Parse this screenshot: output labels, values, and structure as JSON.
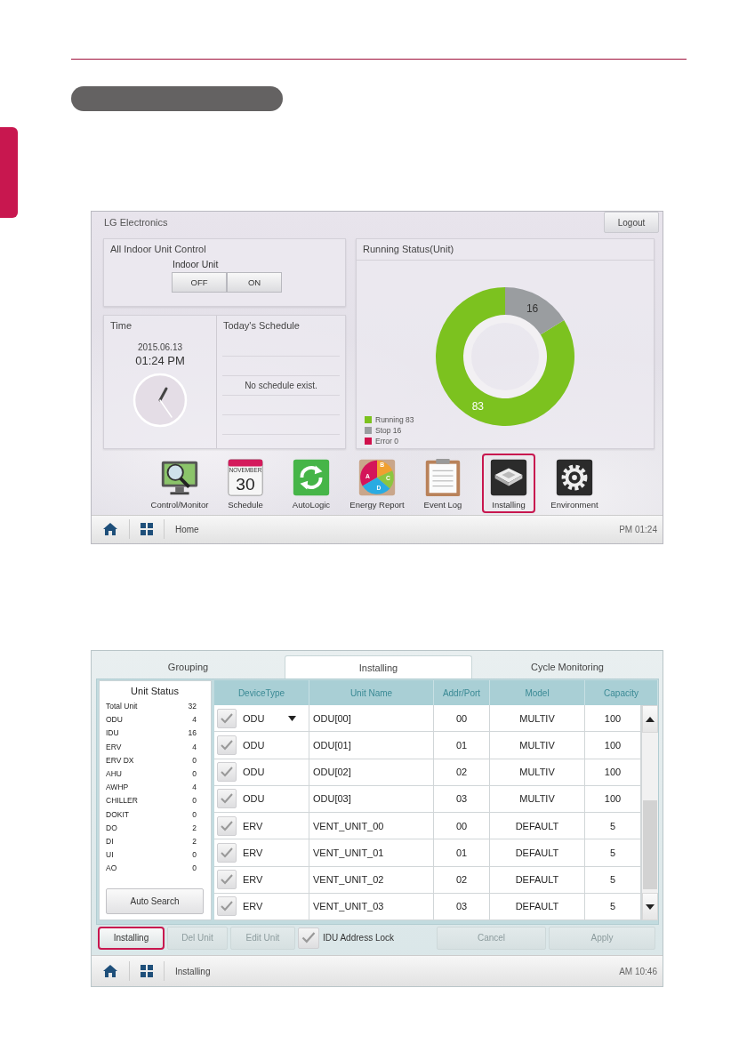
{
  "home_screen": {
    "title": "LG Electronics",
    "logout_button": "Logout",
    "indoor_control": {
      "title": "All Indoor Unit Control",
      "label": "Indoor Unit",
      "buttons": [
        "OFF",
        "ON"
      ]
    },
    "time": {
      "title": "Time",
      "date": "2015.06.13",
      "time": "01:24 PM"
    },
    "schedule": {
      "title": "Today's Schedule",
      "message": "No schedule exist."
    },
    "running_status": {
      "title": "Running Status(Unit)",
      "chart_data": {
        "type": "donut",
        "values": [
          83,
          16,
          0
        ],
        "data_labels": true
      },
      "legend": [
        {
          "label": "Running 83",
          "color": "#7cc21f"
        },
        {
          "label": "Stop 16",
          "color": "#9a9da0"
        },
        {
          "label": "Error 0",
          "color": "#d0104c"
        }
      ]
    },
    "apps": [
      {
        "kind": "monitor",
        "label": "Control/Monitor",
        "highlighted": false
      },
      {
        "kind": "calendar",
        "label": "Schedule",
        "month": "NOVEMBER",
        "day": "30",
        "highlighted": false
      },
      {
        "kind": "autologic",
        "label": "AutoLogic",
        "highlighted": false
      },
      {
        "kind": "energy",
        "label": "Energy Report",
        "letters": [
          "A",
          "B",
          "C",
          "D"
        ],
        "highlighted": false
      },
      {
        "kind": "log",
        "label": "Event Log",
        "highlighted": false
      },
      {
        "kind": "installing",
        "label": "Installing",
        "highlighted": true
      },
      {
        "kind": "environment",
        "label": "Environment",
        "highlighted": false
      }
    ],
    "status_bar": {
      "location": "Home",
      "clock": "PM 01:24"
    }
  },
  "install_screen": {
    "tabs": [
      {
        "label": "Grouping",
        "selected": false
      },
      {
        "label": "Installing",
        "selected": true
      },
      {
        "label": "Cycle Monitoring",
        "selected": false
      }
    ],
    "unit_status": {
      "title": "Unit Status",
      "items": [
        {
          "name": "Total Unit",
          "count": "32"
        },
        {
          "name": "ODU",
          "count": "4"
        },
        {
          "name": "IDU",
          "count": "16"
        },
        {
          "name": "ERV",
          "count": "4"
        },
        {
          "name": "ERV DX",
          "count": "0"
        },
        {
          "name": "AHU",
          "count": "0"
        },
        {
          "name": "AWHP",
          "count": "4"
        },
        {
          "name": "CHILLER",
          "count": "0"
        },
        {
          "name": "DOKIT",
          "count": "0"
        },
        {
          "name": "DO",
          "count": "2"
        },
        {
          "name": "DI",
          "count": "2"
        },
        {
          "name": "UI",
          "count": "0"
        },
        {
          "name": "AO",
          "count": "0"
        }
      ],
      "button": "Auto Search"
    },
    "table": {
      "columns": [
        "DeviceType",
        "Unit Name",
        "Addr/Port",
        "Model",
        "Capacity"
      ],
      "rows": [
        {
          "checked": true,
          "device_type": "ODU",
          "dropdown": true,
          "unit_name": "ODU[00]",
          "addr": "00",
          "model": "MULTIV",
          "capacity": "100"
        },
        {
          "checked": true,
          "device_type": "ODU",
          "dropdown": false,
          "unit_name": "ODU[01]",
          "addr": "01",
          "model": "MULTIV",
          "capacity": "100"
        },
        {
          "checked": true,
          "device_type": "ODU",
          "dropdown": false,
          "unit_name": "ODU[02]",
          "addr": "02",
          "model": "MULTIV",
          "capacity": "100"
        },
        {
          "checked": true,
          "device_type": "ODU",
          "dropdown": false,
          "unit_name": "ODU[03]",
          "addr": "03",
          "model": "MULTIV",
          "capacity": "100"
        },
        {
          "checked": true,
          "device_type": "ERV",
          "dropdown": false,
          "unit_name": "VENT_UNIT_00",
          "addr": "00",
          "model": "DEFAULT",
          "capacity": "5"
        },
        {
          "checked": true,
          "device_type": "ERV",
          "dropdown": false,
          "unit_name": "VENT_UNIT_01",
          "addr": "01",
          "model": "DEFAULT",
          "capacity": "5"
        },
        {
          "checked": true,
          "device_type": "ERV",
          "dropdown": false,
          "unit_name": "VENT_UNIT_02",
          "addr": "02",
          "model": "DEFAULT",
          "capacity": "5"
        },
        {
          "checked": true,
          "device_type": "ERV",
          "dropdown": false,
          "unit_name": "VENT_UNIT_03",
          "addr": "03",
          "model": "DEFAULT",
          "capacity": "5"
        }
      ]
    },
    "actions": [
      {
        "kind": "button",
        "label": "Installing",
        "disabled": false,
        "highlighted": true
      },
      {
        "kind": "button",
        "label": "Del Unit",
        "disabled": true,
        "highlighted": false
      },
      {
        "kind": "button",
        "label": "Edit Unit",
        "disabled": true,
        "highlighted": false
      },
      {
        "kind": "checkbox",
        "label": "IDU Address Lock",
        "checked": true
      },
      {
        "kind": "button",
        "label": "Cancel",
        "disabled": true,
        "highlighted": false
      },
      {
        "kind": "button",
        "label": "Apply",
        "disabled": true,
        "highlighted": false
      }
    ],
    "status_bar": {
      "location": "Installing",
      "clock": "AM 10:46"
    }
  }
}
